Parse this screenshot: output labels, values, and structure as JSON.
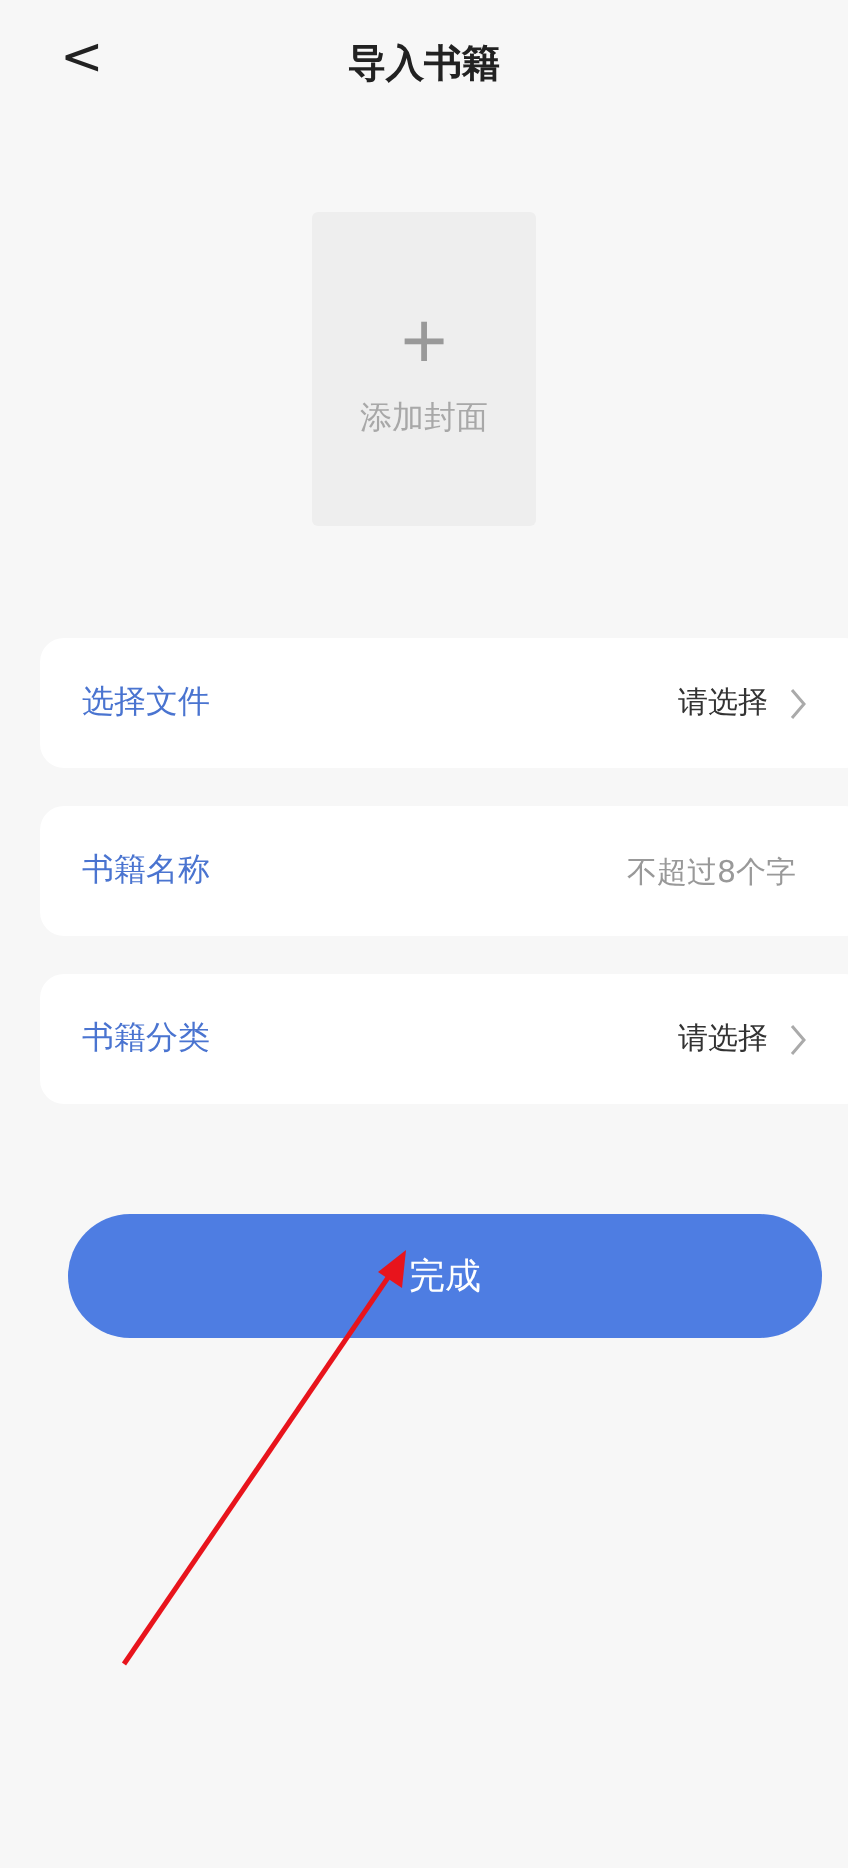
{
  "header": {
    "back": "<",
    "title": "导入书籍"
  },
  "cover": {
    "plus": "+",
    "label": "添加封面"
  },
  "rows": [
    {
      "kind": "select",
      "label": "选择文件",
      "value": "请选择"
    },
    {
      "kind": "input",
      "label": "书籍名称",
      "placeholder": "不超过8个字"
    },
    {
      "kind": "select",
      "label": "书籍分类",
      "value": "请选择"
    }
  ],
  "submit": {
    "label": "完成"
  }
}
